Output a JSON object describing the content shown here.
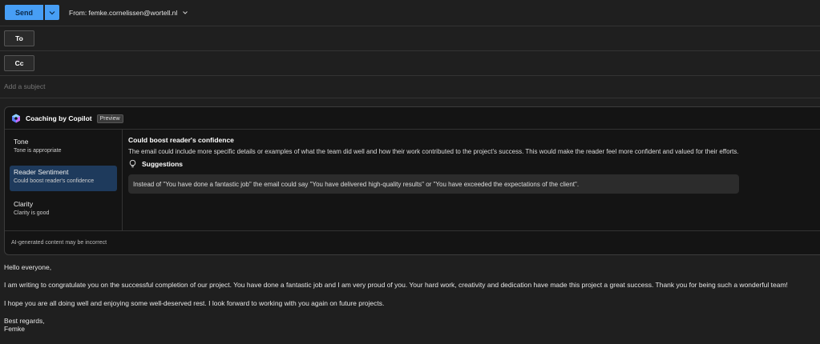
{
  "toolbar": {
    "send_label": "Send",
    "from_label": "From: femke.cornelissen@wortell.nl"
  },
  "recipients": {
    "to_label": "To",
    "cc_label": "Cc"
  },
  "subject": {
    "placeholder": "Add a subject",
    "value": ""
  },
  "coaching": {
    "title": "Coaching by Copilot",
    "badge": "Preview",
    "items": [
      {
        "title": "Tone",
        "subtitle": "Tone is appropriate"
      },
      {
        "title": "Reader Sentiment",
        "subtitle": "Could boost reader's confidence"
      },
      {
        "title": "Clarity",
        "subtitle": "Clarity is good"
      }
    ],
    "detail": {
      "title": "Could boost reader's confidence",
      "description": "The email could include more specific details or examples of what the team did well and how their work contributed to the project's success. This would make the reader feel more confident and valued for their efforts.",
      "suggestions_label": "Suggestions",
      "suggestion": "Instead of \"You have done a fantastic job\" the email could say \"You have delivered high-quality results\" or \"You have exceeded the expectations of the client\"."
    },
    "footer": "AI-generated content may be incorrect"
  },
  "body": {
    "greeting": "Hello everyone,",
    "paragraph1": "I am writing to congratulate you on the successful completion of our project. You have done a fantastic job and I am very proud of you. Your hard work, creativity and dedication have made this project a great success. Thank you for being such a wonderful team!",
    "paragraph2": "I hope you are all doing well and enjoying some well-deserved rest. I look forward to working with you again on future projects.",
    "closing": "Best regards,",
    "signature": "Femke"
  },
  "colors": {
    "accent": "#479ef5",
    "selected": "#1e3a5c",
    "background": "#1f1f1f"
  }
}
